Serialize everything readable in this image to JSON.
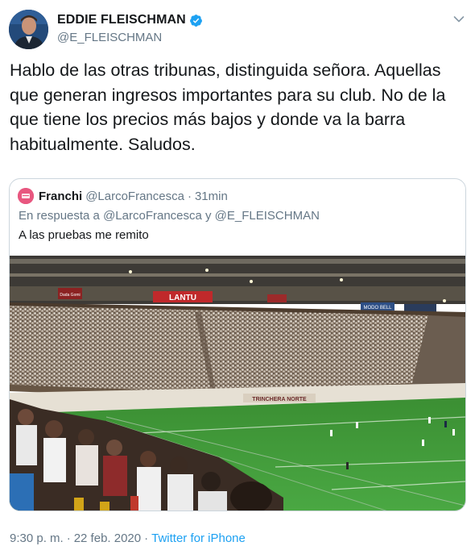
{
  "author": {
    "name": "EDDIE FLEISCHMAN",
    "handle": "@E_FLEISCHMAN",
    "verified": true
  },
  "tweet": {
    "text": "Hablo de las otras tribunas, distinguida señora. Aquellas que generan ingresos importantes para su club. No de la que tiene los precios más bajos y donde va la barra habitualmente. Saludos."
  },
  "quoted": {
    "name": "Franchi",
    "handle": "@LarcoFrancesca",
    "separator": "·",
    "time": "31min",
    "reply_context": "En respuesta a @LarcoFrancesca y @E_FLEISCHMAN",
    "text": "A las pruebas me remito",
    "media_description_icon": "stadium-photo",
    "stadium_signs": [
      "Dada Gomi",
      "LANTU",
      "TRINCHERA NORTE",
      "MODO BELL"
    ]
  },
  "footer": {
    "time": "9:30 p. m.",
    "separator": "·",
    "date": "22 feb. 2020",
    "source": "Twitter for iPhone"
  },
  "colors": {
    "accent": "#1da1f2",
    "secondary_text": "#657786",
    "border": "#ccd6dd",
    "pitch": "#3f9a3a"
  }
}
